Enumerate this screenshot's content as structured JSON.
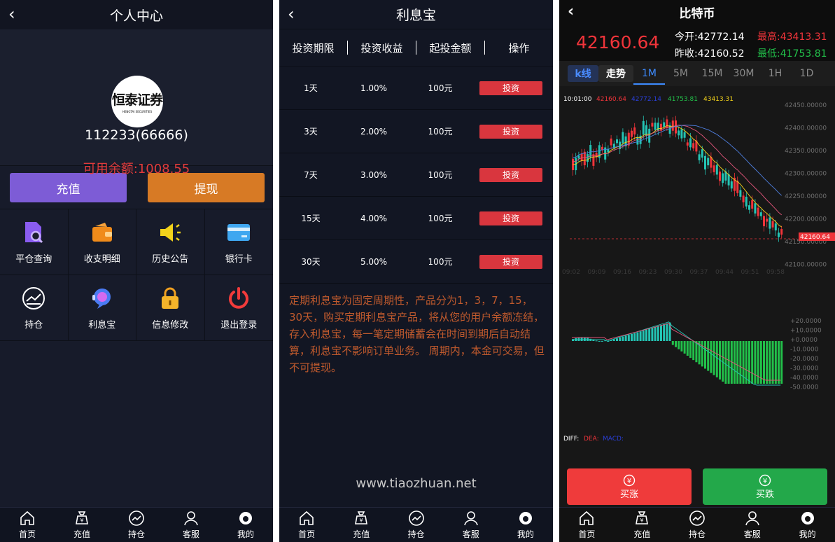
{
  "nav": {
    "items": [
      "首页",
      "充值",
      "持仓",
      "客服",
      "我的"
    ]
  },
  "profile_page": {
    "title": "个人中心",
    "logo_main": "恒泰证券",
    "logo_sub": "HENGTAI SECURITIES",
    "user_id": "112233(66666)",
    "balance_label": "可用余额:",
    "balance_value": "1008.55",
    "recharge_label": "充值",
    "withdraw_label": "提现",
    "menu": [
      {
        "label": "平仓查询",
        "icon": "file-search-icon"
      },
      {
        "label": "收支明细",
        "icon": "wallet-icon"
      },
      {
        "label": "历史公告",
        "icon": "megaphone-icon"
      },
      {
        "label": "银行卡",
        "icon": "bank-card-icon"
      },
      {
        "label": "持仓",
        "icon": "chart-circle-icon"
      },
      {
        "label": "利息宝",
        "icon": "support-bubble-icon"
      },
      {
        "label": "信息修改",
        "icon": "lock-icon"
      },
      {
        "label": "退出登录",
        "icon": "power-icon"
      }
    ],
    "colors": {
      "recharge": "#7d5cd6",
      "withdraw": "#d77a25",
      "balance": "#e23b3b"
    }
  },
  "interest_page": {
    "title": "利息宝",
    "headers": [
      "投资期限",
      "投资收益",
      "起投金额",
      "操作"
    ],
    "rows": [
      {
        "term": "1天",
        "yield": "1.00%",
        "min": "100元",
        "action": "投资"
      },
      {
        "term": "3天",
        "yield": "2.00%",
        "min": "100元",
        "action": "投资"
      },
      {
        "term": "7天",
        "yield": "3.00%",
        "min": "100元",
        "action": "投资"
      },
      {
        "term": "15天",
        "yield": "4.00%",
        "min": "100元",
        "action": "投资"
      },
      {
        "term": "30天",
        "yield": "5.00%",
        "min": "100元",
        "action": "投资"
      }
    ],
    "description": "定期利息宝为固定周期性，产品分为1，3，7，15，30天，购买定期利息宝产品，将从您的用户余额冻结，存入利息宝，每一笔定期储蓄会在时间到期后自动结算，利息宝不影响订单业务。 周期内，本金可交易，但不可提现。",
    "watermark": "www.tiaozhuan.net"
  },
  "market_page": {
    "title": "比特币",
    "price": "42160.64",
    "open_label": "今开:",
    "open_value": "42772.14",
    "high_label": "最高:",
    "high_value": "43413.31",
    "prev_label": "昨收:",
    "prev_value": "42160.52",
    "low_label": "最低:",
    "low_value": "41753.81",
    "tabs": [
      "k线",
      "走势",
      "1M",
      "5M",
      "15M",
      "30M",
      "1H",
      "1D"
    ],
    "info_time": "10:01:00",
    "info_values": [
      "42160.64",
      "42772.14",
      "41753.81",
      "43413.31"
    ],
    "price_axis": [
      "42450.00000",
      "42400.00000",
      "42350.00000",
      "42300.00000",
      "42250.00000",
      "42200.00000",
      "42150.00000",
      "42100.00000"
    ],
    "price_tag": "42160.64",
    "time_axis": [
      "09:02",
      "09:09",
      "09:16",
      "09:23",
      "09:30",
      "09:37",
      "09:44",
      "09:51",
      "09:58"
    ],
    "macd_axis": [
      "+20.0000",
      "+10.0000",
      "+0.0000",
      "-10.0000",
      "-20.0000",
      "-30.0000",
      "-40.0000",
      "-50.0000"
    ],
    "macd_legend": {
      "diff": "DIFF:",
      "dea": "DEA:",
      "macd": "MACD:"
    },
    "buy_up": "买涨",
    "buy_down": "买跌",
    "colors": {
      "up": "#24c4b4",
      "down": "#f0343a",
      "buy_up_btn": "#ef3b3b",
      "buy_down_btn": "#23a84a"
    }
  }
}
